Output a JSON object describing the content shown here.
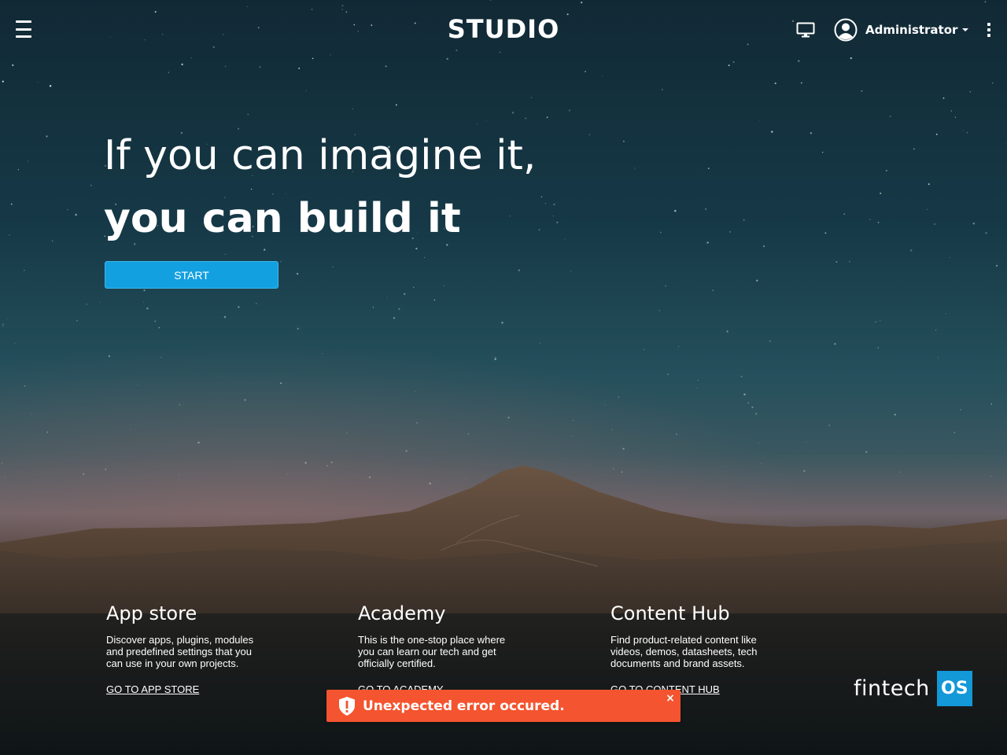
{
  "header": {
    "brand": "STUDIO",
    "menu_icon": "hamburger-menu-icon",
    "monitor_icon": "monitor-icon",
    "user": {
      "avatar_icon": "user-avatar-icon",
      "name": "Administrator",
      "dropdown_icon": "caret-down-icon"
    },
    "more_icon": "vertical-dots-icon"
  },
  "hero": {
    "line1": "If you can imagine it,",
    "line2": "you can build it",
    "start_label": "START",
    "start_color": "#13a0e0"
  },
  "cards": [
    {
      "title": "App store",
      "description": "Discover apps, plugins, modules and predefined settings that you can use in your own projects.",
      "link": "GO TO APP STORE"
    },
    {
      "title": "Academy",
      "description": "This is the one-stop place where you can learn our tech and get officially certified.",
      "link": "GO TO ACADEMY"
    },
    {
      "title": "Content Hub",
      "description": "Find product-related content like videos, demos, datasheets, tech documents and brand assets.",
      "link": "GO TO CONTENT HUB"
    }
  ],
  "footer_logo": {
    "text": "fintech",
    "badge": "OS",
    "badge_color": "#1398d8"
  },
  "toast": {
    "icon": "shield-alert-icon",
    "message": "Unexpected error occured.",
    "close": "×",
    "color": "#f4542f"
  }
}
